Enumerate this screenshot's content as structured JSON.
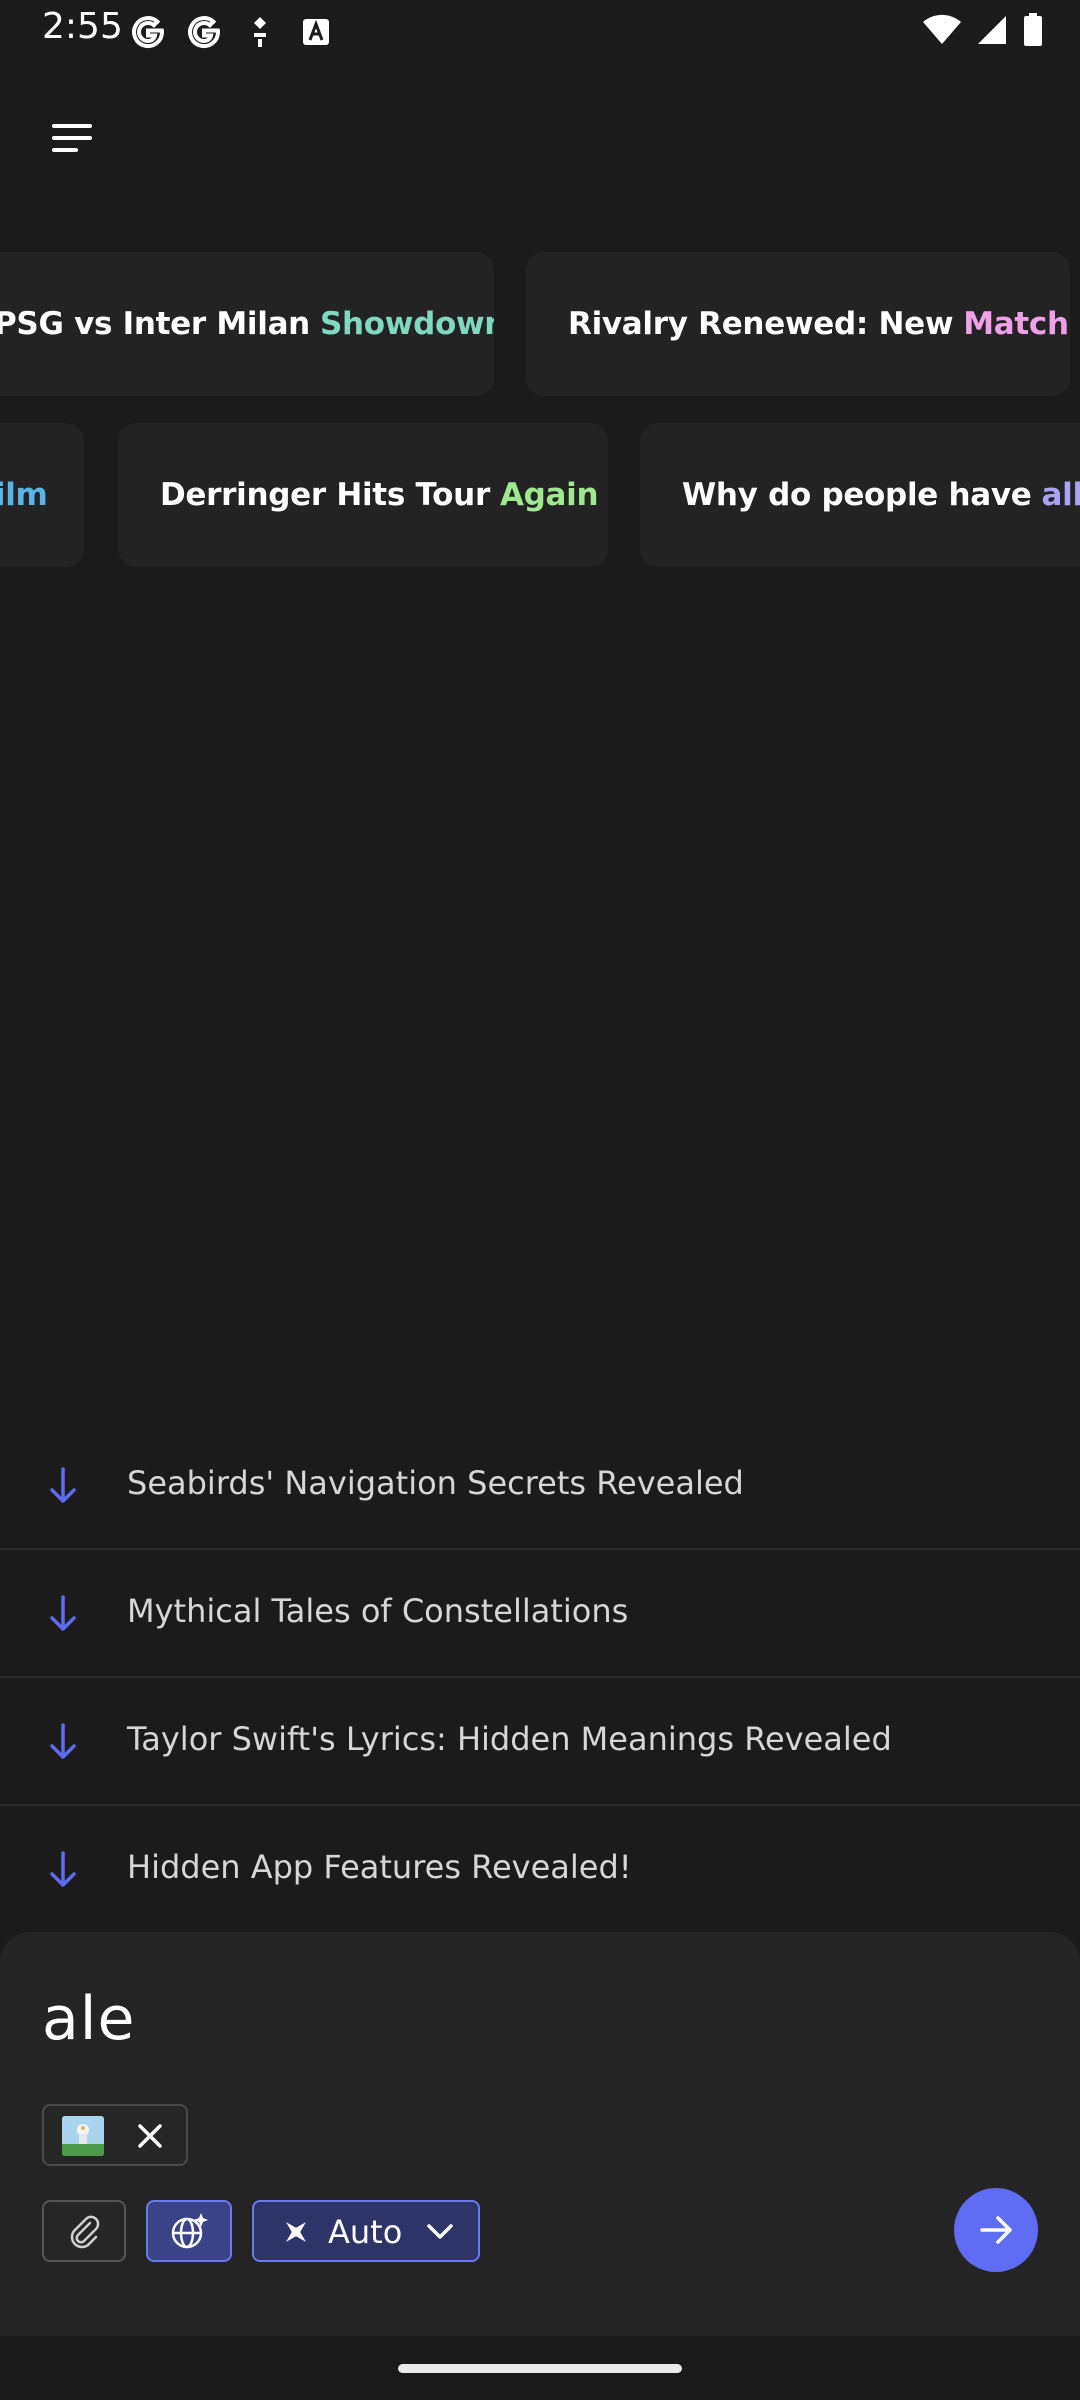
{
  "status_bar": {
    "time": "2:55",
    "left_icons": [
      "google-g-icon",
      "google-g-icon",
      "accessibility-icon",
      "font-a-icon"
    ],
    "right_icons": [
      "wifi-icon",
      "signal-icon",
      "battery-icon"
    ]
  },
  "header": {
    "menu_icon": "hamburger-menu-icon"
  },
  "trending": {
    "row1": [
      {
        "text": "PSG vs Inter Milan",
        "accent": "Showdown",
        "accent_color": "#7fd8c0"
      },
      {
        "text": "Rivalry Renewed: New",
        "accent": "Match",
        "accent_color": "#f0a0e8"
      }
    ],
    "row2": [
      {
        "text": "",
        "accent": "Film",
        "accent_color": "#5ab4e8"
      },
      {
        "text": "Derringer Hits Tour",
        "accent": "Again",
        "accent_color": "#9ee88f"
      },
      {
        "text": "Why do people have",
        "accent": "allergies",
        "accent_color": "#a9a3f5"
      }
    ]
  },
  "suggestions": [
    "Seabirds' Navigation Secrets Revealed",
    "Mythical Tales of Constellations",
    "Taylor Swift's Lyrics: Hidden Meanings Revealed",
    "Hidden App Features Revealed!"
  ],
  "composer": {
    "input_value": "ale",
    "attachment_icon": "image-thumbnail",
    "remove_icon": "close-icon",
    "attach_icon": "paperclip-icon",
    "web_icon": "globe-sparkle-icon",
    "mode_icon": "sparkle-icon",
    "mode_label": "Auto",
    "mode_chevron": "chevron-down-icon",
    "send_icon": "arrow-right-icon"
  },
  "colors": {
    "background": "#1b1b1b",
    "accent": "#5f6cf4",
    "arrow": "#5f6cf4"
  }
}
